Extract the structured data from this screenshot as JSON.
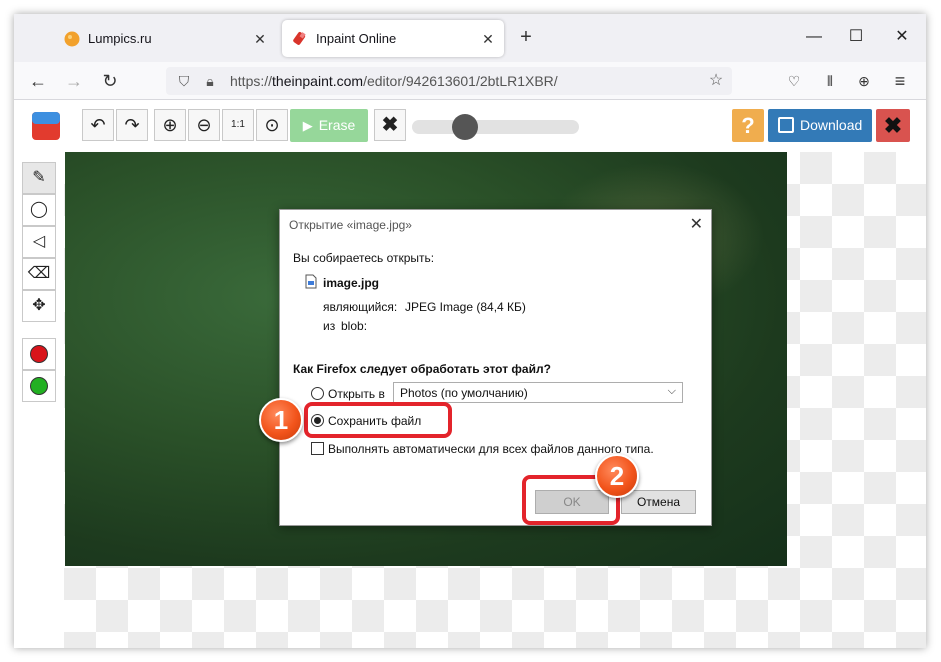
{
  "tabs": [
    {
      "label": "Lumpics.ru",
      "icon": "lumpics-favicon-icon"
    },
    {
      "label": "Inpaint Online",
      "icon": "inpaint-favicon-icon"
    }
  ],
  "url": {
    "prefix": "https://",
    "host": "theinpaint.com",
    "path": "/editor/942613601/2btLR1XBR/"
  },
  "toolbar": {
    "erase_label": "Erase",
    "help_label": "?",
    "download_label": "Download"
  },
  "dialog": {
    "title": "Открытие «image.jpg»",
    "intro": "Вы собираетесь открыть:",
    "file_name": "image.jpg",
    "type_label": "являющийся:",
    "type_value": "JPEG Image (84,4 КБ)",
    "from_label": "из",
    "from_value": "blob:",
    "question": "Как Firefox следует обработать этот файл?",
    "open_with_label": "Открыть в",
    "open_with_app": "Photos (по умолчанию)",
    "save_label": "Сохранить файл",
    "auto_label": "Выполнять автоматически для всех файлов данного типа.",
    "ok_label": "OK",
    "cancel_label": "Отмена"
  },
  "annotations": {
    "step1": "1",
    "step2": "2",
    "color": "#e3242b"
  }
}
